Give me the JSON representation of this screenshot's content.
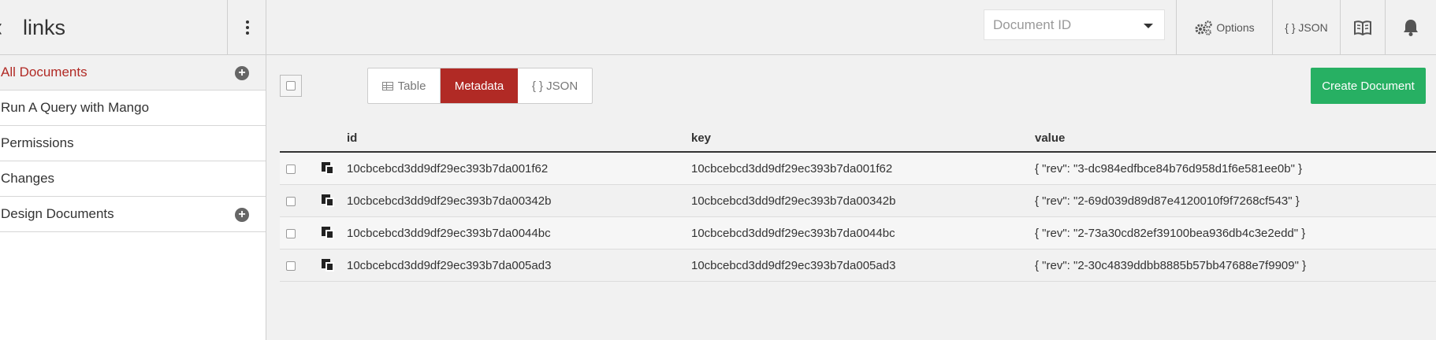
{
  "sidebar": {
    "db_name": "links",
    "items": [
      {
        "label": "All Documents",
        "active": true,
        "has_add": true
      },
      {
        "label": "Run A Query with Mango",
        "active": false,
        "has_add": false
      },
      {
        "label": "Permissions",
        "active": false,
        "has_add": false
      },
      {
        "label": "Changes",
        "active": false,
        "has_add": false
      },
      {
        "label": "Design Documents",
        "active": false,
        "has_add": true
      }
    ]
  },
  "topbar": {
    "doc_id_placeholder": "Document ID",
    "options_label": "Options",
    "json_label": "{ } JSON"
  },
  "controls": {
    "view_table": "Table",
    "view_metadata": "Metadata",
    "view_json": "{ } JSON",
    "create_document": "Create Document"
  },
  "table": {
    "headers": {
      "id": "id",
      "key": "key",
      "value": "value"
    },
    "rows": [
      {
        "id": "10cbcebcd3dd9df29ec393b7da001f62",
        "key": "10cbcebcd3dd9df29ec393b7da001f62",
        "value": "{ \"rev\": \"3-dc984edfbce84b76d958d1f6e581ee0b\" }"
      },
      {
        "id": "10cbcebcd3dd9df29ec393b7da00342b",
        "key": "10cbcebcd3dd9df29ec393b7da00342b",
        "value": "{ \"rev\": \"2-69d039d89d87e4120010f9f7268cf543\" }"
      },
      {
        "id": "10cbcebcd3dd9df29ec393b7da0044bc",
        "key": "10cbcebcd3dd9df29ec393b7da0044bc",
        "value": "{ \"rev\": \"2-73a30cd82ef39100bea936db4c3e2edd\" }"
      },
      {
        "id": "10cbcebcd3dd9df29ec393b7da005ad3",
        "key": "10cbcebcd3dd9df29ec393b7da005ad3",
        "value": "{ \"rev\": \"2-30c4839ddbb8885b57bb47688e7f9909\" }"
      }
    ]
  },
  "colors": {
    "accent": "#b12a25",
    "create": "#27b063"
  }
}
